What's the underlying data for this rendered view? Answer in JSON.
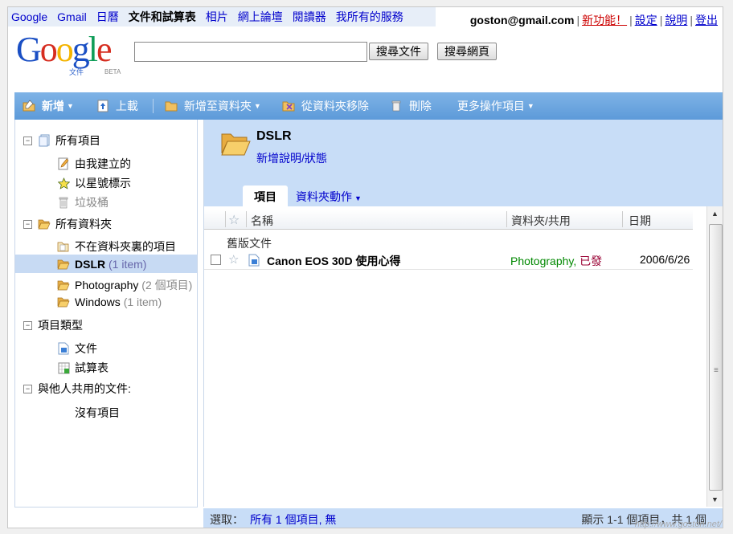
{
  "topnav": {
    "items": [
      "Google",
      "Gmail",
      "日曆",
      "文件和試算表",
      "相片",
      "網上論壇",
      "閱讀器",
      "我所有的服務"
    ],
    "current_index": 3
  },
  "user": {
    "email": "goston@gmail.com",
    "new_features": "新功能！",
    "settings": "設定",
    "help": "說明",
    "logout": "登出"
  },
  "logo": {
    "word": "Google",
    "sub": "文件",
    "beta": "BETA"
  },
  "search": {
    "value": "",
    "search_docs": "搜尋文件",
    "search_web": "搜尋網頁"
  },
  "toolbar": {
    "new": "新增",
    "upload": "上載",
    "add_to_folder": "新增至資料夾",
    "remove_from_folder": "從資料夾移除",
    "delete": "刪除",
    "more_actions": "更多操作項目"
  },
  "sidebar": {
    "all_items": "所有項目",
    "created_by_me": "由我建立的",
    "starred": "以星號標示",
    "trash": "垃圾桶",
    "all_folders": "所有資料夾",
    "not_in_folder": "不在資料夾裏的項目",
    "folders": [
      {
        "name": "DSLR",
        "count": "(1 item)"
      },
      {
        "name": "Photography",
        "count": "(2 個項目)"
      },
      {
        "name": "Windows",
        "count": "(1 item)"
      }
    ],
    "item_types": "項目類型",
    "type_doc": "文件",
    "type_sheet": "試算表",
    "shared_with_others": "與他人共用的文件:",
    "no_items": "沒有項目"
  },
  "folder": {
    "title": "DSLR",
    "description_link": "新增說明/狀態",
    "tab_items": "項目",
    "tab_actions": "資料夾動作"
  },
  "table": {
    "col_name": "名稱",
    "col_folder_share": "資料夾/共用",
    "col_date": "日期",
    "group": "舊版文件",
    "rows": [
      {
        "name": "Canon EOS 30D 使用心得",
        "folder": "Photography",
        "share": "已發",
        "date": "2006/6/26"
      }
    ]
  },
  "footer": {
    "select_label": "選取：",
    "select_links": "所有 1 個項目, 無",
    "pager": "顯示 1-1 個項目，共 1 個"
  },
  "watermark": "http://www.goston.net/",
  "colors": {
    "toolbar": "#6aa4df",
    "panel_bg": "#c8ddf7",
    "link": "#0000cc",
    "folder_icon": "#f0b848"
  }
}
